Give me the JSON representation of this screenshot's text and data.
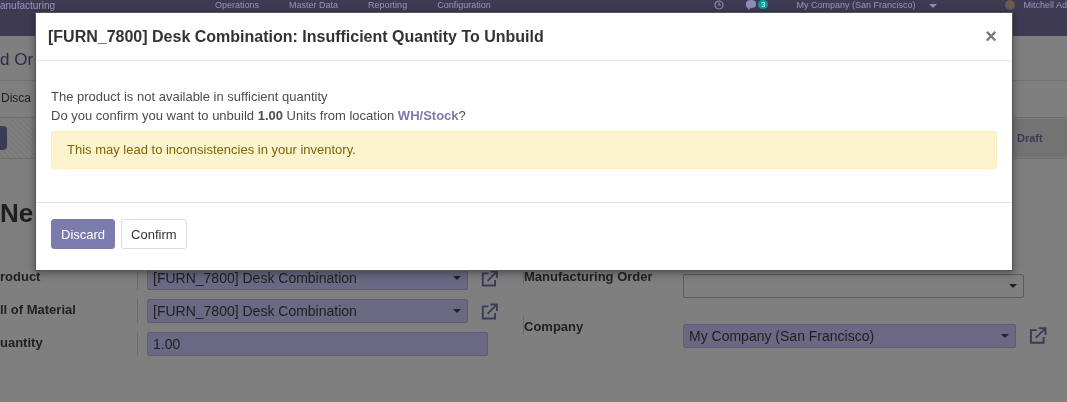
{
  "navbar": {
    "app_name": "anufacturing",
    "menus": [
      "Operations",
      "Master Data",
      "Reporting",
      "Configuration"
    ],
    "message_count": "3",
    "company": "My Company (San Francisco)",
    "user": "Mitchell Ad"
  },
  "breadcrumb": "d Or",
  "control_buttons": [
    "Disca"
  ],
  "status_stages": [
    {
      "label": "Draft",
      "selected": false
    }
  ],
  "record_title": "Ne",
  "form_left": [
    {
      "label": "roduct",
      "value": "[FURN_7800] Desk Combination",
      "kind": "select",
      "link": true
    },
    {
      "label": "ll of Material",
      "value": "[FURN_7800] Desk Combination",
      "kind": "select",
      "link": true
    },
    {
      "label": "uantity",
      "value": "1.00",
      "kind": "input",
      "link": false
    }
  ],
  "form_right": [
    {
      "label": "Manufacturing Order",
      "kind": "select",
      "link": false
    },
    {
      "label": "Company",
      "value": "My Company (San Francisco)",
      "kind": "select",
      "link": true
    }
  ],
  "dialog": {
    "title": "[FURN_7800] Desk Combination: Insufficient Quantity To Unbuild",
    "close": "×",
    "message": "The product is not available in sufficient quantity",
    "question": "Do you confirm you want to unbuild **1.00** Units from location ",
    "location_link": "WH/Stock",
    "question_end": "?",
    "alert": "This may lead to inconsistencies in your inventory.",
    "buttons": [
      {
        "label": "Discard",
        "kind": "primary"
      },
      {
        "label": "Confirm",
        "kind": "secondary"
      }
    ]
  }
}
